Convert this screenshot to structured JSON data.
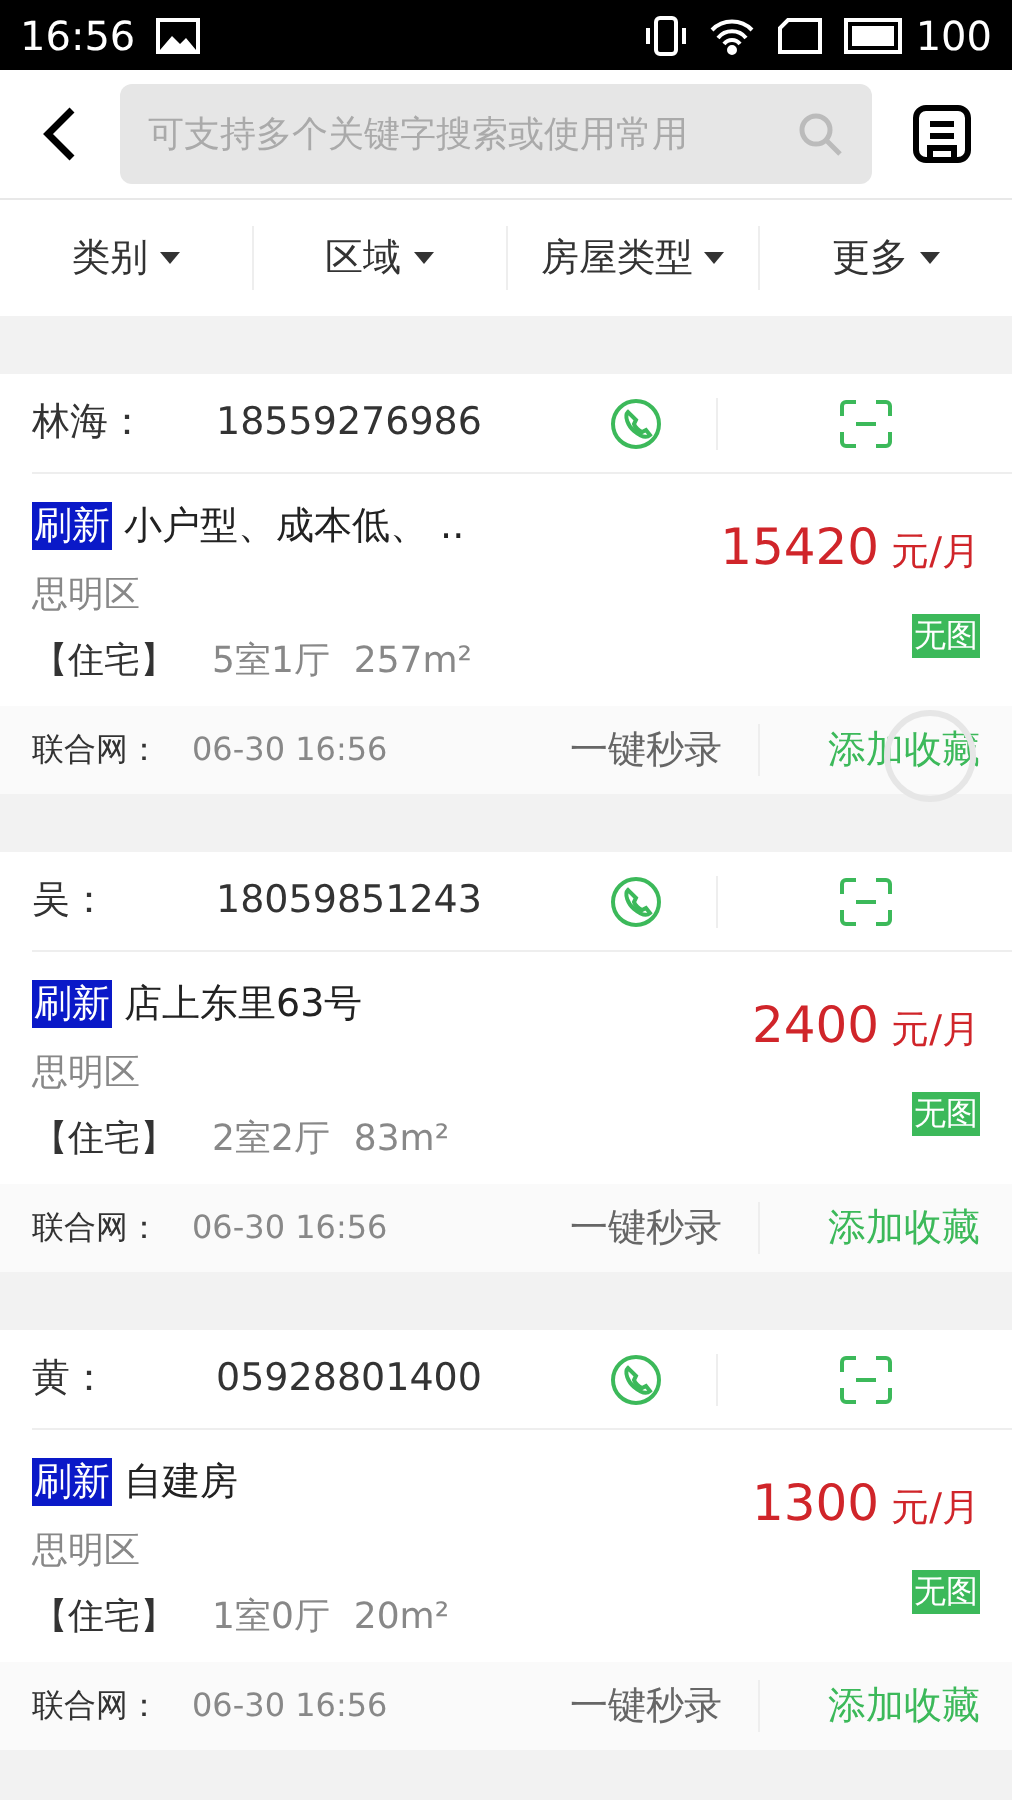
{
  "status_bar": {
    "time": "16:56",
    "battery": "100"
  },
  "search": {
    "placeholder": "可支持多个关键字搜索或使用常用"
  },
  "filters": [
    {
      "label": "类别"
    },
    {
      "label": "区域"
    },
    {
      "label": "房屋类型"
    },
    {
      "label": "更多"
    }
  ],
  "listings": [
    {
      "contact": "林海：",
      "phone": "18559276986",
      "badge": "刷新",
      "title": "小户型、成本低、 ..",
      "price": "15420",
      "unit": "元/月",
      "district": "思明区",
      "type": "【住宅】",
      "layout": "5室1厅",
      "area": "257m²",
      "image_tag": "无图",
      "source": "联合网：",
      "time": "06-30 16:56",
      "quick_action": "一键秒录",
      "favorite": "添加收藏"
    },
    {
      "contact": "吴：",
      "phone": "18059851243",
      "badge": "刷新",
      "title": "店上东里63号",
      "price": "2400",
      "unit": "元/月",
      "district": "思明区",
      "type": "【住宅】",
      "layout": "2室2厅",
      "area": "83m²",
      "image_tag": "无图",
      "source": "联合网：",
      "time": "06-30 16:56",
      "quick_action": "一键秒录",
      "favorite": "添加收藏"
    },
    {
      "contact": "黄：",
      "phone": "05928801400",
      "badge": "刷新",
      "title": "自建房",
      "price": "1300",
      "unit": "元/月",
      "district": "思明区",
      "type": "【住宅】",
      "layout": "1室0厅",
      "area": "20m²",
      "image_tag": "无图",
      "source": "联合网：",
      "time": "06-30 16:56",
      "quick_action": "一键秒录",
      "favorite": "添加收藏"
    }
  ]
}
